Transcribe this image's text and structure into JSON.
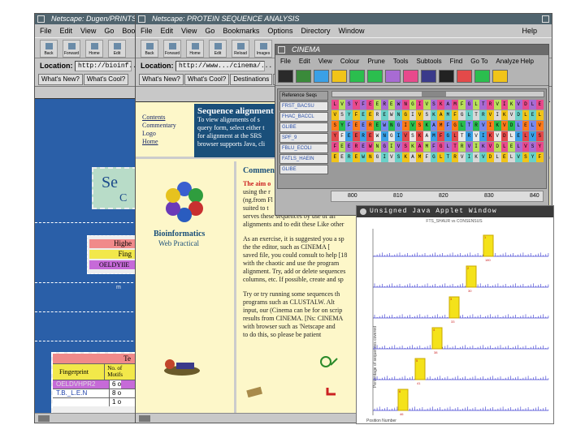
{
  "win1": {
    "title": "Netscape: Dugen/PRINTS/...",
    "menu": [
      "File",
      "Edit",
      "View",
      "Go",
      "Bookm"
    ],
    "toolbar": [
      "Back",
      "Forward",
      "Home",
      "Edit"
    ],
    "location_label": "Location:",
    "location_value": "http://bioinf...",
    "dir_buttons": [
      "What's New?",
      "What's Cool?"
    ],
    "page": {
      "title_frag1": "Se",
      "title_frag2": "C",
      "box_rows": [
        "Highe",
        "Fing",
        "OELDYIIE"
      ],
      "hr_mark": "m",
      "table_head": "Te",
      "table_cols": [
        "Fingerprint",
        "No. of Motifs"
      ],
      "table_rows": [
        [
          "OELDVHPR2",
          "6 o"
        ],
        [
          "T.B._L.E.N",
          "8 o"
        ],
        [
          "",
          "1 o"
        ]
      ]
    }
  },
  "win2": {
    "title": "Netscape: PROTEIN SEQUENCE ANALYSIS",
    "menu": [
      "File",
      "Edit",
      "View",
      "Go",
      "Bookmarks",
      "Options",
      "Directory",
      "Window"
    ],
    "help": "Help",
    "toolbar": [
      "Back",
      "Forward",
      "Home",
      "Edit",
      "Reload",
      "Images"
    ],
    "location_label": "Location:",
    "location_value": "http://www.../cinema/...",
    "dir_buttons": [
      "What's New?",
      "What's Cool?",
      "Destinations",
      "Ne"
    ],
    "nav": [
      "Contents",
      "Commentary",
      "Logo",
      "Home"
    ],
    "heading": "Sequence alignment",
    "intro": [
      "To view alignments of s",
      "query form, select either t",
      "for alignment at the SRS",
      "browser supports Java, cli"
    ],
    "logo_title": "Bioinformatics",
    "logo_sub": "Web Practical",
    "comment_title": "Commen",
    "p1_red": "The aim o",
    "p1": [
      "using the r",
      "(ng.from Fl",
      "suited to t"
    ],
    "p1b": [
      "serves these sequences by use of an",
      "alignments and to edit these Like other"
    ],
    "p2": [
      "As an exercise, it is suggested you a sp",
      "the the editor, such as CINEMA [",
      "saved file, you could consult to help [18",
      "with the chaotic and use the program",
      "alignment. Try, add or delete sequences",
      "columns, etc. If possible, create and sp"
    ],
    "p3": [
      "Try or try running some sequences th",
      "programs such as CLUSTALW. Alt",
      "input, our (Cinema can be for on scrip",
      "results from CINEMA. [Ns: CINEMA",
      "with browser such as 'Netscape and",
      "to do this, so please be patient"
    ]
  },
  "cinema": {
    "title": "CINEMA",
    "menu": [
      "File",
      "Edit",
      "View",
      "Colour",
      "Prune",
      "Tools",
      "Subtools",
      "Find",
      "Go To",
      "Analyze"
    ],
    "help": "Help",
    "seq_names": [
      "Reference Seqs",
      "FRST_BACSU",
      "FHAC_BACCL",
      "GLIBE",
      "SPF_9",
      "FBLU_ECOLI",
      "FATLS_HAEIN",
      "GLIBE"
    ],
    "ruler": [
      "800",
      "810",
      "820",
      "830",
      "840"
    ],
    "colors": [
      "#e84a8c",
      "#3aa0e6",
      "#2bbe4e",
      "#f1c419",
      "#a86bd3",
      "#e8e8e8",
      "#ff7a1a",
      "#6ad1c8",
      "#b8e05a",
      "#e34a4a",
      "#7788ee",
      "#d8d8d8"
    ]
  },
  "applet": {
    "title": "Unsigned Java Applet Window",
    "plot_title": "FTS_SHAUR vs CONSENSUS",
    "ylabel": "Percentage of sequences covered",
    "xlabel": "Position Number",
    "peaks": [
      {
        "label": "1",
        "value": "180"
      },
      {
        "label": "2",
        "value": "30"
      },
      {
        "label": "3",
        "value": "33"
      },
      {
        "label": "4",
        "value": "38"
      },
      {
        "label": "5",
        "value": "41"
      },
      {
        "label": "6",
        "value": "46"
      }
    ]
  }
}
